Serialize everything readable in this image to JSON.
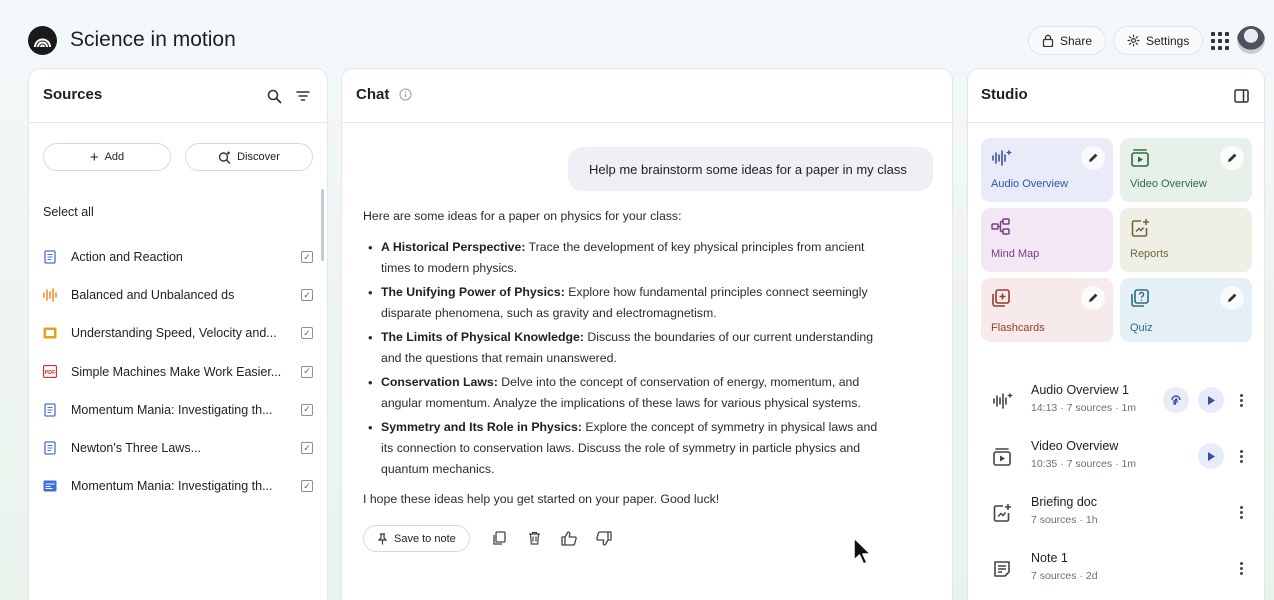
{
  "app": {
    "title": "Science in motion",
    "share_label": "Share",
    "settings_label": "Settings"
  },
  "sources": {
    "title": "Sources",
    "add_label": "Add",
    "discover_label": "Discover",
    "select_all_label": "Select all",
    "items": [
      {
        "label": "Action and Reaction",
        "icon": "document-icon",
        "color": "#4a6fd6",
        "checked": true
      },
      {
        "label": "Balanced and Unbalanced ds",
        "icon": "audio-icon",
        "color": "#f08a24",
        "checked": true
      },
      {
        "label": "Understanding Speed, Velocity and...",
        "icon": "slides-icon",
        "color": "#e8a117",
        "checked": true
      },
      {
        "label": "Simple Machines Make Work Easier...",
        "icon": "pdf-icon",
        "color": "#d93025",
        "checked": true
      },
      {
        "label": "Momentum Mania: Investigating th...",
        "icon": "document-icon",
        "color": "#4a6fd6",
        "checked": true
      },
      {
        "label": "Newton's Three Laws...",
        "icon": "document-icon",
        "color": "#4a6fd6",
        "checked": true
      },
      {
        "label": "Momentum Mania: Investigating th...",
        "icon": "web-icon",
        "color": "#3c6fd6",
        "checked": true
      }
    ]
  },
  "chat": {
    "title": "Chat",
    "user_message": "Help me brainstorm some ideas for a paper in my class",
    "response_intro": "Here are some ideas for a paper on physics for your class:",
    "bullets": [
      {
        "bold": "A Historical Perspective:",
        "text": " Trace the development of key physical principles from ancient times to modern physics."
      },
      {
        "bold": "The Unifying Power of Physics:",
        "text": " Explore how fundamental principles connect seemingly disparate phenomena, such as gravity and electromagnetism."
      },
      {
        "bold": "The Limits of Physical Knowledge:",
        "text": " Discuss the boundaries of our current understanding and the questions that remain unanswered."
      },
      {
        "bold": "Conservation Laws:",
        "text": " Delve into the concept of conservation of energy, momentum, and angular momentum. Analyze the implications of these laws for various physical systems."
      },
      {
        "bold": "Symmetry and Its Role in Physics:",
        "text": " Explore the concept of symmetry in physical laws and its connection to conservation laws. Discuss the role of symmetry in particle physics and quantum mechanics."
      }
    ],
    "response_outro": "I hope these ideas help you get started on your paper. Good luck!",
    "save_to_note_label": "Save to note"
  },
  "studio": {
    "title": "Studio",
    "tiles": [
      {
        "label": "Audio Overview",
        "bg": "#e9ecf8",
        "color": "#3950a8",
        "icon": "audio-overview-icon",
        "editable": true
      },
      {
        "label": "Video Overview",
        "bg": "#e7f1ea",
        "color": "#2e6b3f",
        "icon": "video-overview-icon",
        "editable": true
      },
      {
        "label": "Mind Map",
        "bg": "#f1e8f3",
        "color": "#7a3b86",
        "icon": "mind-map-icon",
        "editable": false
      },
      {
        "label": "Reports",
        "bg": "#f0efe6",
        "color": "#6b6a3a",
        "icon": "reports-icon",
        "editable": false
      },
      {
        "label": "Flashcards",
        "bg": "#f6ebea",
        "color": "#9b3a2f",
        "icon": "flashcards-icon",
        "editable": true
      },
      {
        "label": "Quiz",
        "bg": "#e4f0f6",
        "color": "#2d6a86",
        "icon": "quiz-icon",
        "editable": true
      }
    ],
    "artifacts": [
      {
        "title": "Audio Overview 1",
        "meta": "14:13 · 7 sources · 1m",
        "icon": "audio-overview-icon"
      },
      {
        "title": "Video Overview",
        "meta": "10:35 · 7 sources · 1m",
        "icon": "video-overview-icon"
      },
      {
        "title": "Briefing doc",
        "meta": "7 sources · 1h",
        "icon": "reports-icon"
      },
      {
        "title": "Note 1",
        "meta": "7 sources · 2d",
        "icon": "note-icon"
      }
    ]
  }
}
